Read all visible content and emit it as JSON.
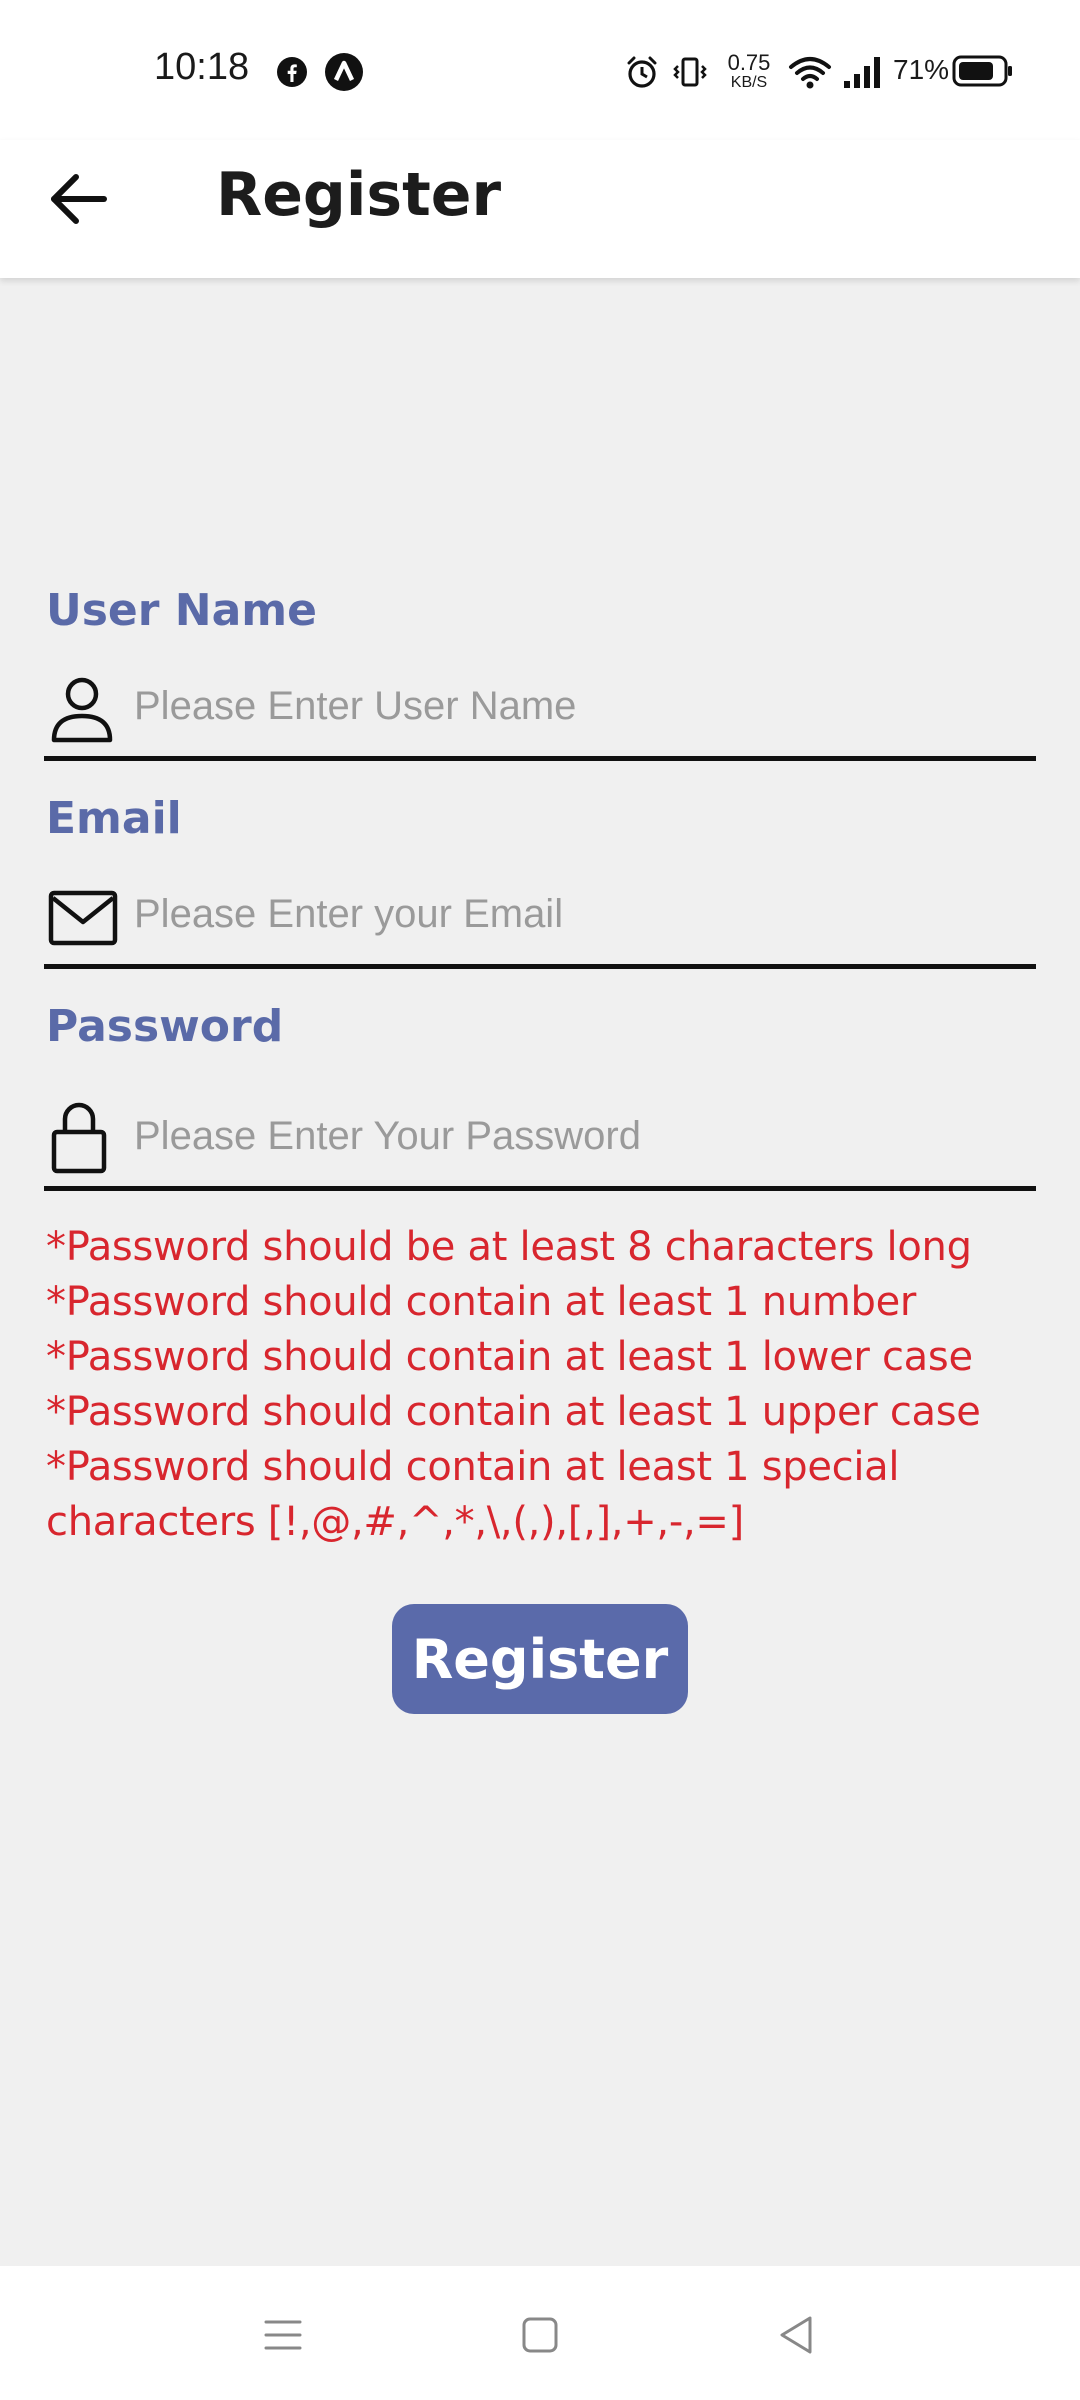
{
  "status_bar": {
    "time": "10:18",
    "net_speed_value": "0.75",
    "net_speed_unit": "KB/S",
    "battery_percent": "71%",
    "icons": [
      "facebook-icon",
      "notification-app-icon",
      "alarm-icon",
      "vibrate-icon",
      "wifi-icon",
      "signal-icon",
      "battery-icon"
    ]
  },
  "app_bar": {
    "title": "Register",
    "back_icon": "arrow-left-icon"
  },
  "form": {
    "username": {
      "label": "User Name",
      "placeholder": "Please Enter User Name",
      "value": "",
      "icon": "person-icon"
    },
    "email": {
      "label": "Email",
      "placeholder": "Please Enter your Email",
      "value": "",
      "icon": "mail-icon"
    },
    "password": {
      "label": "Password",
      "placeholder": "Please Enter Your Password",
      "value": "",
      "icon": "lock-icon"
    },
    "password_rules": [
      "*Password should be at least 8 characters long",
      "*Password should contain at least 1 number",
      "*Password should contain at least 1 lower case",
      "*Password should contain at least 1 upper case",
      "*Password should contain at least 1 special characters [!,@,#,^,*,\\,(,),[,],+,-,=]"
    ],
    "submit_label": "Register"
  },
  "nav_bar": {
    "icons": [
      "menu-icon",
      "home-square-icon",
      "back-triangle-icon"
    ]
  },
  "colors": {
    "accent": "#5a6aa8",
    "error": "#d8262e",
    "background": "#f0f0f0"
  }
}
